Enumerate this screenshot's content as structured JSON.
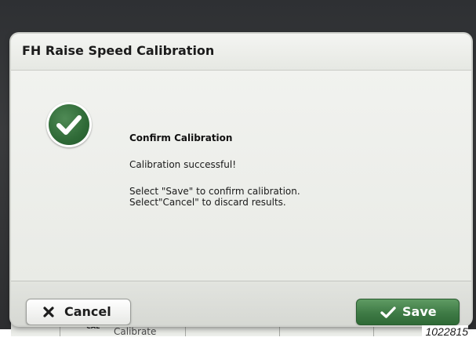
{
  "dialog": {
    "title": "FH Raise Speed Calibration",
    "heading": "Confirm Calibration",
    "success_message": "Calibration successful!",
    "save_instruction": "Select \"Save\" to confirm calibration.",
    "cancel_instruction": "Select\"Cancel\" to discard results."
  },
  "buttons": {
    "cancel_label": "Cancel",
    "save_label": "Save"
  },
  "underlay": {
    "cal_label": "CAL",
    "calibrate_label": "Calibrate"
  },
  "figure_number": "1022815",
  "icons": {
    "status": "check-circle-icon",
    "cancel": "x-icon",
    "save": "checkmark-icon"
  },
  "colors": {
    "accent_green": "#3e7a45",
    "dialog_bg": "#eef0ec",
    "bezel": "#2e3033"
  }
}
